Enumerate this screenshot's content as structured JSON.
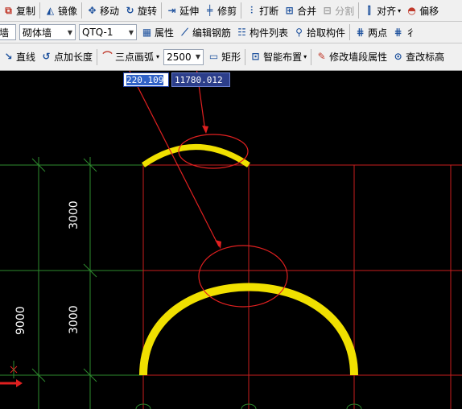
{
  "toolbar1": {
    "copy": "复制",
    "mirror": "镜像",
    "move": "移动",
    "rotate": "旋转",
    "extend": "延伸",
    "trim": "修剪",
    "break": "打断",
    "merge": "合并",
    "split": "分割",
    "align": "对齐",
    "offset": "偏移"
  },
  "toolbar2": {
    "layer_fragment": "墙",
    "wall_type": "砌体墙",
    "component": "QTQ-1",
    "properties": "属性",
    "edit_rebar": "编辑钢筋",
    "component_list": "构件列表",
    "pick_component": "拾取构件",
    "two_points": "两点",
    "parallel_fragment": "彳"
  },
  "toolbar3": {
    "line": "直线",
    "point_length": "点加长度",
    "three_point_arc": "三点画弧",
    "radius_value": "2500",
    "rectangle": "矩形",
    "smart_layout": "智能布置",
    "modify_segment_props": "修改墙段属性",
    "view_fragment": "查改标高"
  },
  "coords": {
    "x": "220.109",
    "y": "11780.012"
  },
  "canvas": {
    "dim_top": "3000",
    "dim_mid": "3000",
    "dim_total": "9000"
  },
  "colors": {
    "grid_green": "#2e8b2e",
    "axis_red": "#c81e1e",
    "wall_yellow": "#f0e000",
    "annotation_red": "#e02020",
    "dimension_text": "#ffffff"
  }
}
